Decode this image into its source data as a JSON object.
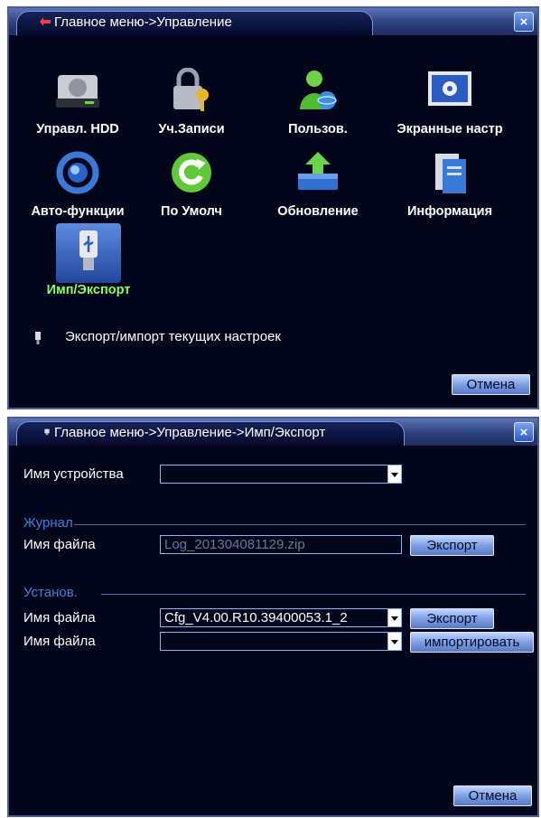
{
  "window1": {
    "title": "Главное меню->Управление",
    "icons": [
      {
        "label": "Управл. HDD",
        "icon": "hdd-icon"
      },
      {
        "label": "Уч.Записи",
        "icon": "lock-key-icon"
      },
      {
        "label": "Пользов.",
        "icon": "users-icon"
      },
      {
        "label": "Экранные настр",
        "icon": "monitor-settings-icon"
      },
      {
        "label": "Авто-функции",
        "icon": "auto-cycle-icon"
      },
      {
        "label": "По Умолч",
        "icon": "reset-icon"
      },
      {
        "label": "Обновление",
        "icon": "upgrade-icon"
      },
      {
        "label": "Информация",
        "icon": "info-icon"
      },
      {
        "label": "Имп/Экспорт",
        "icon": "usb-icon"
      }
    ],
    "hint": "Экспорт/импорт текущих настроек",
    "cancel_label": "Отмена",
    "colors": {
      "bg": "#03051a",
      "selected_label": "#8cff5a"
    }
  },
  "window2": {
    "title": "Главное меню->Управление->Имп/Экспорт",
    "device_label": "Имя устройства",
    "device_value": "",
    "log_section": "Журнал",
    "log_file_label": "Имя файла",
    "log_file_value": "Log_201304081129.zip",
    "log_export_label": "Экспорт",
    "config_section": "Установ.",
    "config_file_label": "Имя файла",
    "config_file_value": "Cfg_V4.00.R10.39400053.1_2",
    "config_export_label": "Экспорт",
    "import_file_label": "Имя файла",
    "import_file_value": "",
    "import_label": "импортировать",
    "cancel_label": "Отмена",
    "colors": {
      "section": "#3e82d6"
    }
  }
}
